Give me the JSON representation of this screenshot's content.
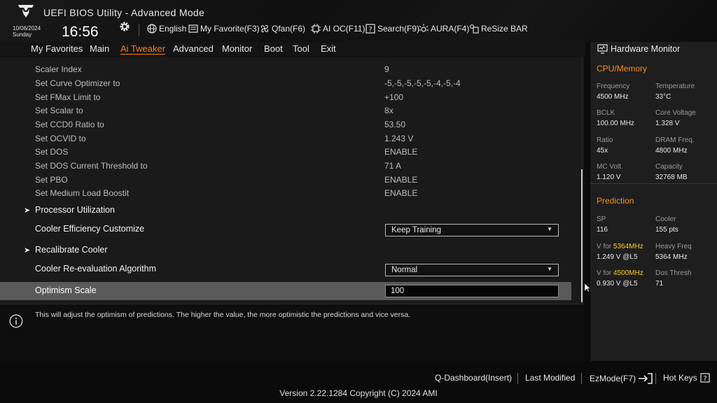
{
  "header": {
    "title": "UEFI BIOS Utility - Advanced Mode",
    "date": "10/06/2024",
    "day": "Sunday",
    "time": "16:56",
    "toolbar": {
      "language": "English",
      "favorite": "My Favorite(F3)",
      "qfan": "Qfan(F6)",
      "aioc": "AI OC(F11)",
      "search": "Search(F9)",
      "aura": "AURA(F4)",
      "resizebar": "ReSize BAR"
    }
  },
  "menu": {
    "items": [
      "My Favorites",
      "Main",
      "Ai Tweaker",
      "Advanced",
      "Monitor",
      "Boot",
      "Tool",
      "Exit"
    ],
    "active": "Ai Tweaker"
  },
  "settings": [
    {
      "label": "Scaler Index",
      "value": "9"
    },
    {
      "label": "Set Curve Optimizer to",
      "value": "-5,-5,-5,-5,-5,-4,-5,-4"
    },
    {
      "label": "Set FMax Limit to",
      "value": "+100"
    },
    {
      "label": "Set Scalar to",
      "value": "8x"
    },
    {
      "label": "Set CCD0 Ratio to",
      "value": "53.50"
    },
    {
      "label": "Set OCVID to",
      "value": "1.243 V"
    },
    {
      "label": "Set DOS",
      "value": "ENABLE"
    },
    {
      "label": "Set DOS Current Threshold to",
      "value": "71 A"
    },
    {
      "label": "Set PBO",
      "value": "ENABLE"
    },
    {
      "label": "Set Medium Load Boostit",
      "value": "ENABLE"
    }
  ],
  "submenus": {
    "processor_utilization": "Processor Utilization",
    "recalibrate_cooler": "Recalibrate Cooler"
  },
  "options": {
    "cooler_efficiency": {
      "label": "Cooler Efficiency Customize",
      "value": "Keep Training"
    },
    "reevaluation": {
      "label": "Cooler Re-evaluation Algorithm",
      "value": "Normal"
    },
    "optimism": {
      "label": "Optimism Scale",
      "value": "100"
    }
  },
  "help": {
    "text": "This will adjust the optimism of predictions. The higher the value, the more optimistic the predictions and vice versa."
  },
  "hardware_monitor": {
    "title": "Hardware Monitor",
    "cpu_memory": {
      "heading": "CPU/Memory",
      "frequency_label": "Frequency",
      "frequency": "4500 MHz",
      "temperature_label": "Temperature",
      "temperature": "33°C",
      "bclk_label": "BCLK",
      "bclk": "100.00 MHz",
      "core_voltage_label": "Core Voltage",
      "core_voltage": "1.328 V",
      "ratio_label": "Ratio",
      "ratio": "45x",
      "dram_label": "DRAM Freq.",
      "dram": "4800 MHz",
      "mc_volt_label": "MC Volt.",
      "mc_volt": "1.120 V",
      "capacity_label": "Capacity",
      "capacity": "32768 MB"
    },
    "prediction": {
      "heading": "Prediction",
      "sp_label": "SP",
      "sp": "116",
      "cooler_label": "Cooler",
      "cooler": "155 pts",
      "vfor_prefix": "V for ",
      "vfor1_freq": "5364MHz",
      "vfor1": "1.249 V @L5",
      "heavy_label": "Heavy Freq",
      "heavy": "5364 MHz",
      "vfor2_freq": "4500MHz",
      "vfor2": "0.930 V @L5",
      "dos_label": "Dos Thresh",
      "dos": "71"
    }
  },
  "footer": {
    "qdashboard": "Q-Dashboard(Insert)",
    "last_modified": "Last Modified",
    "ezmode": "EzMode(F7)",
    "hotkeys": "Hot Keys",
    "version": "Version 2.22.1284 Copyright (C) 2024 AMI"
  },
  "colors": {
    "accent": "#ff7b1c",
    "highlight": "#ffcc1a",
    "selected_row": "#5a5a5a"
  },
  "icons": [
    "tuf-logo-icon",
    "gear-icon",
    "globe-icon",
    "favorite-icon",
    "fan-icon",
    "ai-oc-icon",
    "search-icon",
    "aura-icon",
    "resize-bar-icon",
    "info-icon",
    "monitor-icon",
    "ezmode-icon",
    "hotkeys-icon",
    "cursor-icon"
  ]
}
